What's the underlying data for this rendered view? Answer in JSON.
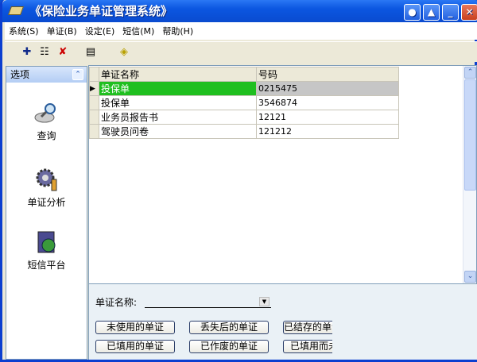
{
  "window": {
    "title": "《保险业务单证管理系统》"
  },
  "menu": [
    "系统(S)",
    "单证(B)",
    "设定(E)",
    "短信(M)",
    "帮助(H)"
  ],
  "sidebar": {
    "header": "选项",
    "items": [
      {
        "label": "查询",
        "icon": "magnifier-icon"
      },
      {
        "label": "单证分析",
        "icon": "gear-analysis-icon"
      },
      {
        "label": "短信平台",
        "icon": "sms-globe-icon"
      }
    ]
  },
  "grid": {
    "columns": [
      "单证名称",
      "号码"
    ],
    "rows": [
      [
        "投保单",
        "0215475"
      ],
      [
        "投保单",
        "3546874"
      ],
      [
        "业务员报告书",
        "12121"
      ],
      [
        "驾驶员问卷",
        "121212"
      ]
    ]
  },
  "filter": {
    "label": "单证名称:",
    "value": ""
  },
  "buttons": [
    [
      "未使用的单证",
      "丢失后的单证",
      "已结存的单证"
    ],
    [
      "已填用的单证",
      "已作废的单证",
      "已填用而未"
    ]
  ]
}
